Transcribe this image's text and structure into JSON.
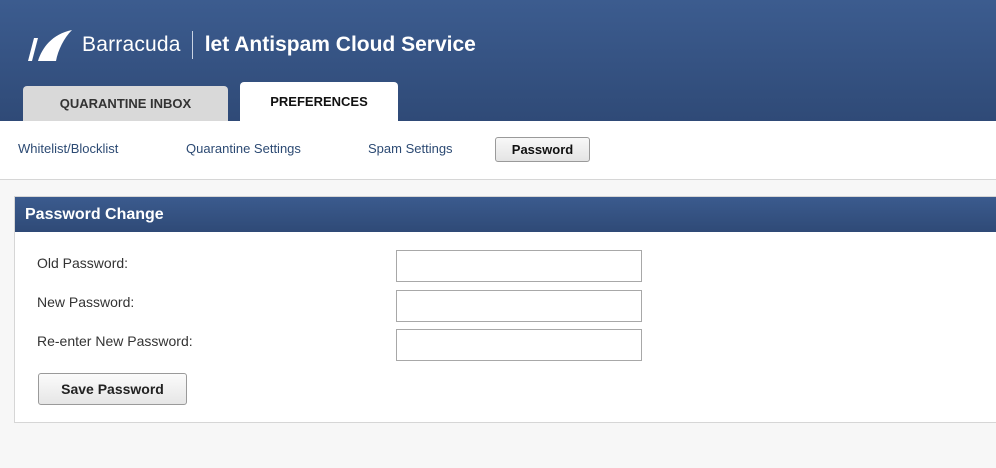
{
  "header": {
    "brand_name": "Barracuda",
    "product_name": "let Antispam Cloud Service",
    "logo_icon": "barracuda-fin-logo"
  },
  "tabs": [
    {
      "label": "QUARANTINE INBOX",
      "active": false
    },
    {
      "label": "PREFERENCES",
      "active": true
    }
  ],
  "subnav": {
    "items": [
      "Whitelist/Blocklist",
      "Quarantine Settings",
      "Spam Settings"
    ],
    "active_item": "Password"
  },
  "panel": {
    "title": "Password Change",
    "fields": [
      {
        "label": "Old Password:",
        "value": ""
      },
      {
        "label": "New Password:",
        "value": ""
      },
      {
        "label": "Re-enter New Password:",
        "value": ""
      }
    ],
    "save_label": "Save Password"
  },
  "colors": {
    "header_bg": "#35527f",
    "link": "#2c4a73",
    "page_bg": "#f7f7f7"
  }
}
